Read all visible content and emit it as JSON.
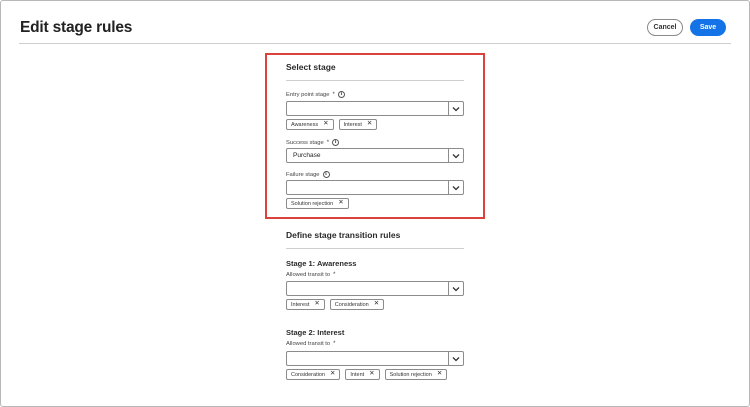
{
  "header": {
    "title": "Edit stage rules",
    "cancel_label": "Cancel",
    "save_label": "Save"
  },
  "select_stage": {
    "title": "Select stage",
    "entry": {
      "label": "Entry point stage",
      "required_mark": "*",
      "value": "",
      "tags": [
        "Awareness",
        "Interest"
      ]
    },
    "success": {
      "label": "Success stage",
      "required_mark": "*",
      "value": "Purchase"
    },
    "failure": {
      "label": "Failure stage",
      "value": "",
      "tags": [
        "Solution rejection"
      ]
    }
  },
  "transition_rules": {
    "title": "Define stage transition rules",
    "stages": [
      {
        "title": "Stage 1: Awareness",
        "label": "Allowed transit to",
        "required_mark": "*",
        "value": "",
        "tags": [
          "Interest",
          "Consideration"
        ]
      },
      {
        "title": "Stage 2: Interest",
        "label": "Allowed transit to",
        "required_mark": "*",
        "value": "",
        "tags": [
          "Consideration",
          "Intent",
          "Solution rejection"
        ]
      }
    ]
  },
  "icons": {
    "info": "info-icon",
    "dropdown": "chevron-down-icon",
    "remove": "close-icon"
  },
  "colors": {
    "accent": "#1473e6",
    "highlight": "#d9433b"
  }
}
